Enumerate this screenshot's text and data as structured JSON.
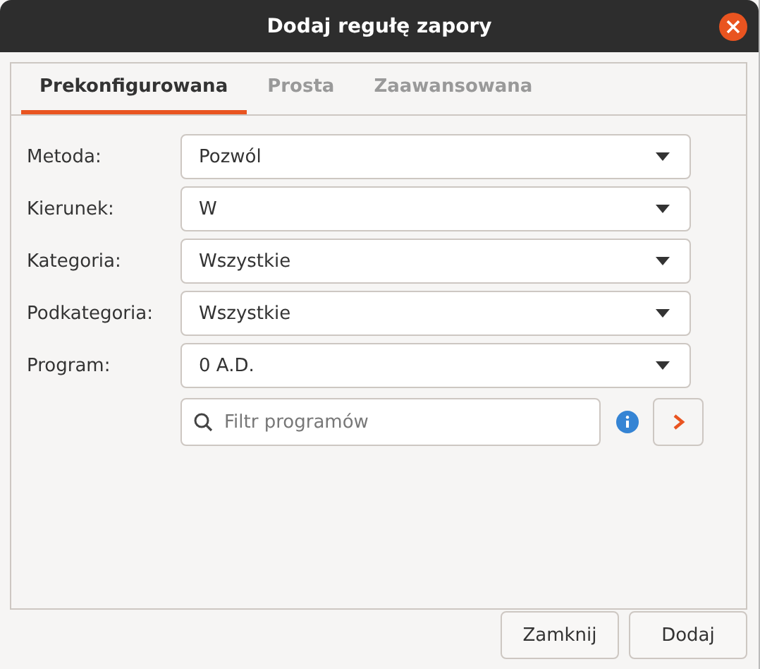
{
  "window": {
    "title": "Dodaj regułę zapory"
  },
  "tabs": [
    {
      "label": "Prekonfigurowana",
      "selected": true
    },
    {
      "label": "Prosta",
      "selected": false
    },
    {
      "label": "Zaawansowana",
      "selected": false
    }
  ],
  "fields": [
    {
      "label": "Metoda:",
      "value": "Pozwól"
    },
    {
      "label": "Kierunek:",
      "value": "W"
    },
    {
      "label": "Kategoria:",
      "value": "Wszystkie"
    },
    {
      "label": "Podkategoria:",
      "value": "Wszystkie"
    },
    {
      "label": "Program:",
      "value": "0 A.D."
    }
  ],
  "search": {
    "placeholder": "Filtr programów"
  },
  "buttons": [
    "Zamknij",
    "Dodaj"
  ]
}
